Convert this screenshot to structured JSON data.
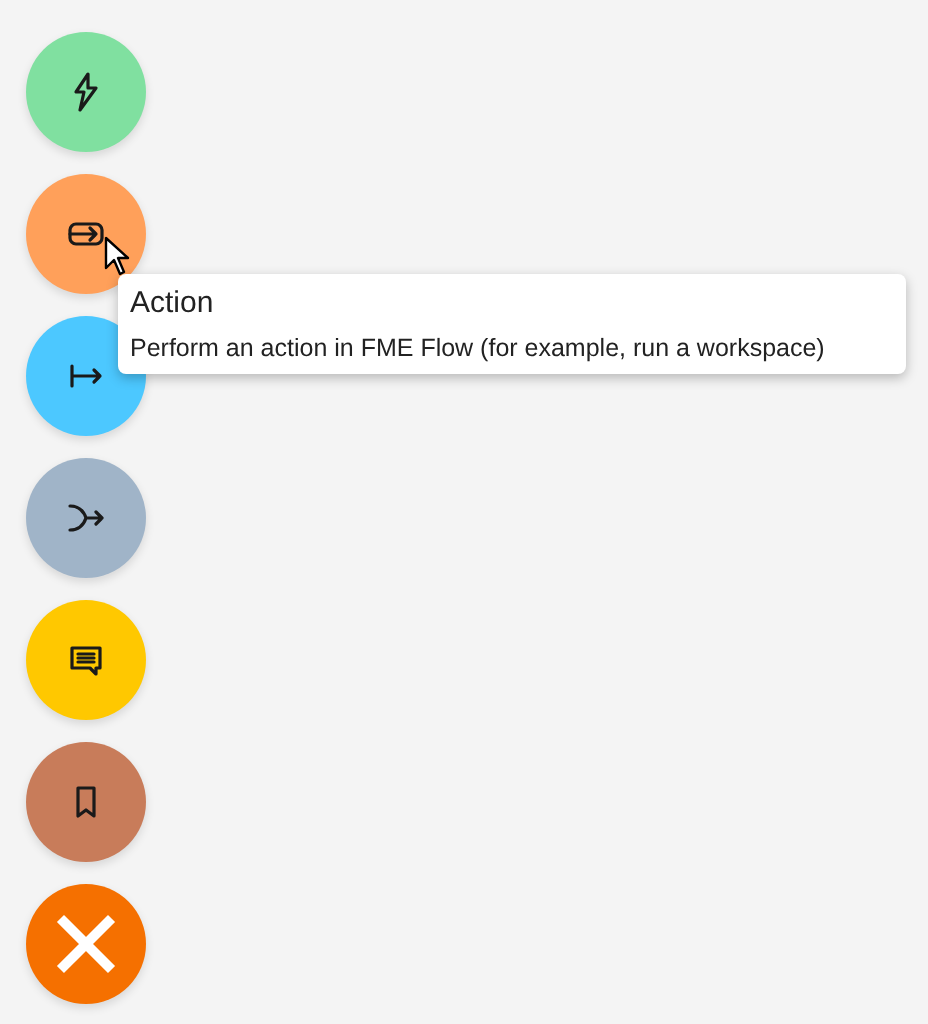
{
  "actions": [
    {
      "kind": "bolt",
      "color": "#80e0a0"
    },
    {
      "kind": "action",
      "color": "#ffa05a"
    },
    {
      "kind": "exit",
      "color": "#4cc8ff"
    },
    {
      "kind": "merge",
      "color": "#a0b4c8"
    },
    {
      "kind": "message",
      "color": "#ffc800"
    },
    {
      "kind": "bookmark",
      "color": "#c87c5a"
    }
  ],
  "close_button": {
    "color": "#f57000"
  },
  "tooltip": {
    "title": "Action",
    "text": "Perform an action in FME Flow (for example, run a workspace)"
  }
}
